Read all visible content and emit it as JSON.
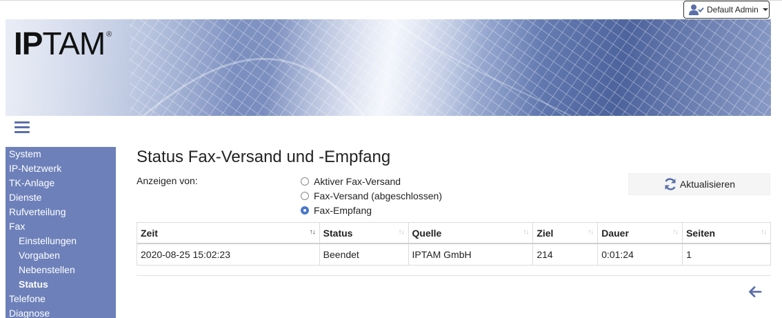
{
  "header": {
    "user_label": "Default Admin",
    "logo_text_bold": "IP",
    "logo_text_rest": "TAM",
    "logo_registered": "®"
  },
  "sidebar": {
    "items": [
      {
        "label": "System"
      },
      {
        "label": "IP-Netzwerk"
      },
      {
        "label": "TK-Anlage"
      },
      {
        "label": "Dienste"
      },
      {
        "label": "Rufverteilung"
      },
      {
        "label": "Fax"
      },
      {
        "label": "Einstellungen"
      },
      {
        "label": "Vorgaben"
      },
      {
        "label": "Nebenstellen"
      },
      {
        "label": "Status"
      },
      {
        "label": "Telefone"
      },
      {
        "label": "Diagnose"
      }
    ]
  },
  "main": {
    "title": "Status Fax-Versand und -Empfang",
    "show_label": "Anzeigen von:",
    "radios": [
      {
        "label": "Aktiver Fax-Versand",
        "checked": false
      },
      {
        "label": "Fax-Versand (abgeschlossen)",
        "checked": false
      },
      {
        "label": "Fax-Empfang",
        "checked": true
      }
    ],
    "refresh_label": "Aktualisieren",
    "table": {
      "headers": [
        "Zeit",
        "Status",
        "Quelle",
        "Ziel",
        "Dauer",
        "Seiten"
      ],
      "rows": [
        [
          "2020-08-25 15:02:23",
          "Beendet",
          "IPTAM GmbH",
          "214",
          "0:01:24",
          "1"
        ]
      ]
    }
  },
  "colors": {
    "accent": "#5a6fa8",
    "sidebar": "#6d80b9",
    "radio_checked": "#4a78c8"
  }
}
